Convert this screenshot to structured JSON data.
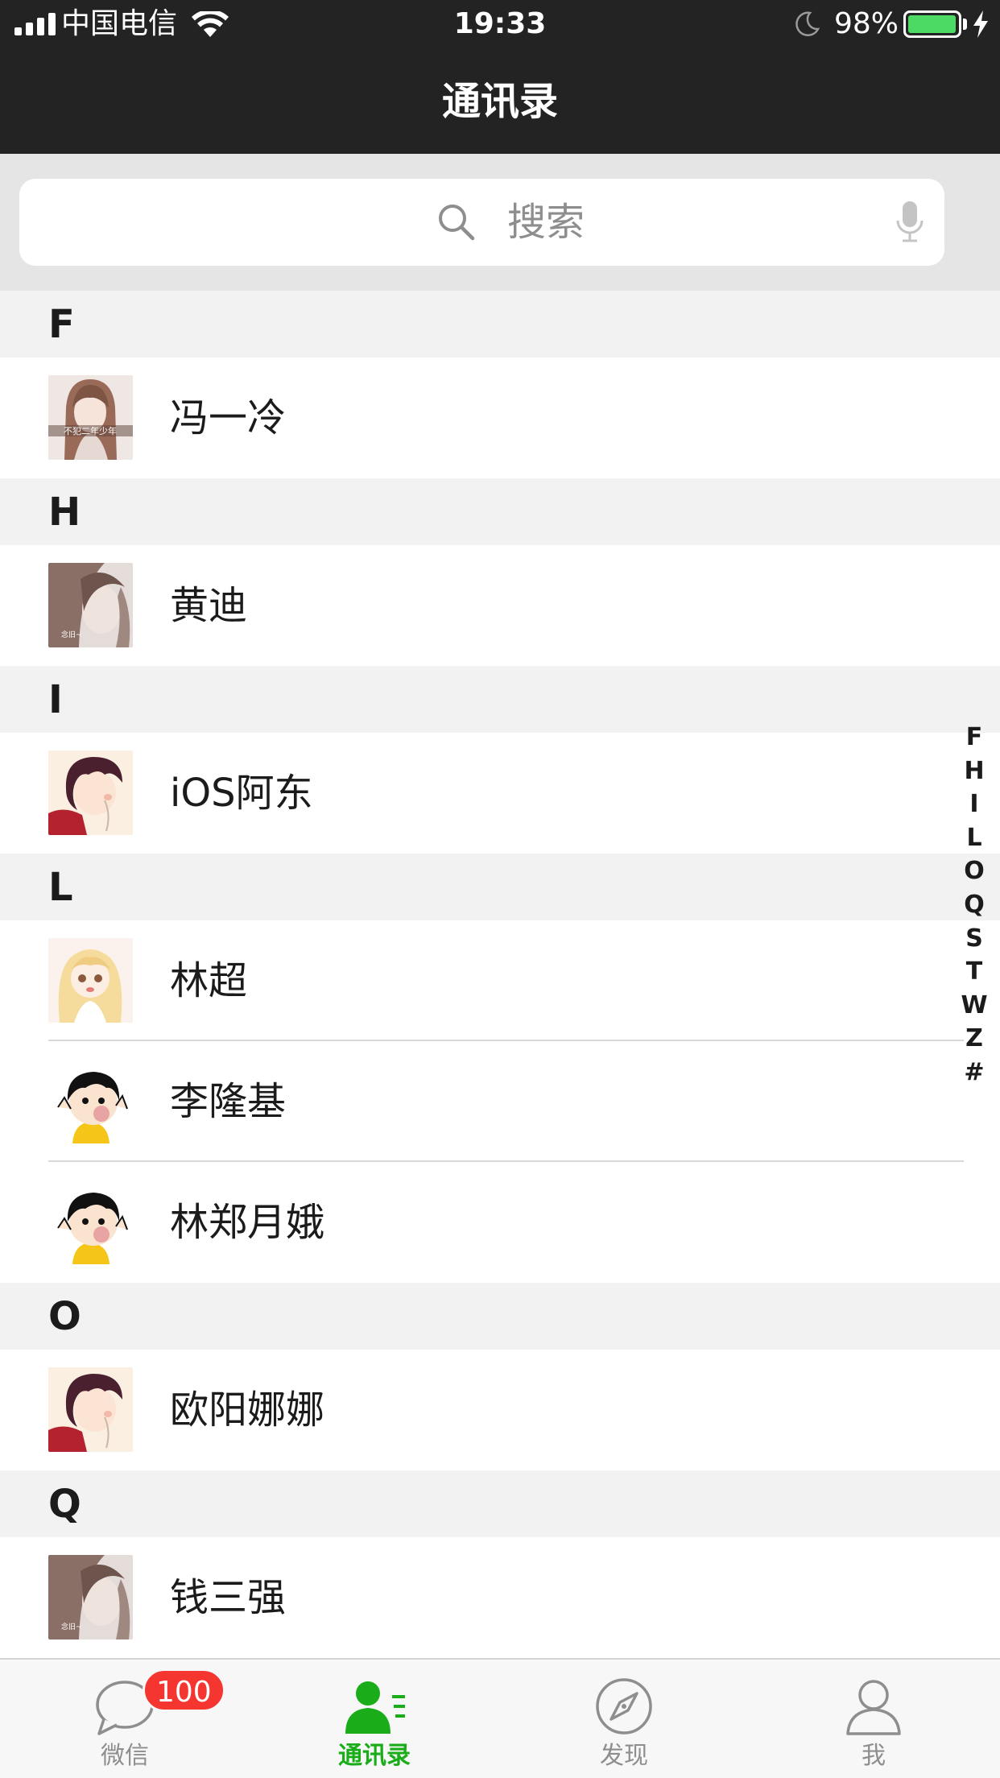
{
  "status_bar": {
    "carrier": "中国电信",
    "time": "19:33",
    "battery_percent": "98%",
    "battery_level": 0.98,
    "battery_color": "#4cd964"
  },
  "nav": {
    "title": "通讯录"
  },
  "search": {
    "placeholder": "搜索",
    "icon": "search-icon",
    "mic_icon": "microphone-icon"
  },
  "sections": [
    {
      "letter": "F",
      "contacts": [
        {
          "name": "冯一冷",
          "avatar": "avatar-girl-photo"
        }
      ]
    },
    {
      "letter": "H",
      "contacts": [
        {
          "name": "黄迪",
          "avatar": "avatar-girl-sketch"
        }
      ]
    },
    {
      "letter": "I",
      "contacts": [
        {
          "name": "iOS阿东",
          "avatar": "avatar-anime-boy"
        }
      ]
    },
    {
      "letter": "L",
      "contacts": [
        {
          "name": "林超",
          "avatar": "avatar-anime-girl"
        },
        {
          "name": "李隆基",
          "avatar": "avatar-cartoon-kid"
        },
        {
          "name": "林郑月娥",
          "avatar": "avatar-cartoon-kid"
        }
      ]
    },
    {
      "letter": "O",
      "contacts": [
        {
          "name": "欧阳娜娜",
          "avatar": "avatar-anime-boy"
        }
      ]
    },
    {
      "letter": "Q",
      "contacts": [
        {
          "name": "钱三强",
          "avatar": "avatar-girl-sketch"
        }
      ]
    }
  ],
  "index_letters": [
    "F",
    "H",
    "I",
    "L",
    "O",
    "Q",
    "S",
    "T",
    "W",
    "Z",
    "#"
  ],
  "tabbar": {
    "tabs": [
      {
        "label": "微信",
        "icon": "chat-bubble-icon",
        "badge": "100",
        "active": false
      },
      {
        "label": "通讯录",
        "icon": "contacts-icon",
        "active": true
      },
      {
        "label": "发现",
        "icon": "compass-icon",
        "active": false
      },
      {
        "label": "我",
        "icon": "person-icon",
        "active": false
      }
    ],
    "active_color": "#1aad19",
    "inactive_color": "#8e8e8e",
    "badge_color": "#f43530"
  },
  "colors": {
    "header_bg": "#232323",
    "section_bg": "#f2f2f2",
    "search_bg": "#e5e5e5"
  }
}
